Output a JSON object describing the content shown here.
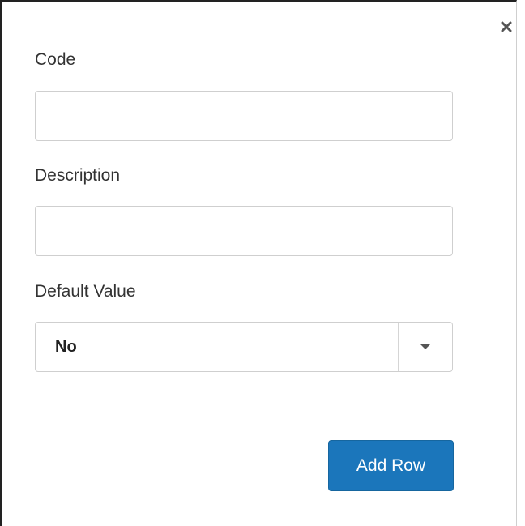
{
  "dialog": {
    "close_icon": "close-icon",
    "fields": {
      "code": {
        "label": "Code",
        "value": "",
        "placeholder": ""
      },
      "description": {
        "label": "Description",
        "value": "",
        "placeholder": ""
      },
      "default_value": {
        "label": "Default Value",
        "selected": "No",
        "arrow_icon": "caret-down-icon"
      }
    },
    "add_row_label": "Add Row",
    "colors": {
      "primary_button": "#1b76bb",
      "border": "#cfcfcf",
      "text": "#333333"
    }
  }
}
